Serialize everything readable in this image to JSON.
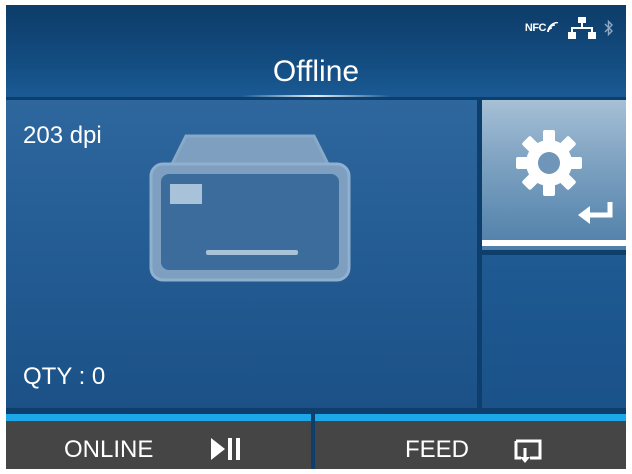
{
  "status": {
    "title": "Offline",
    "nfc_label": "NFC",
    "icons": [
      "nfc-icon",
      "network-icon",
      "bluetooth-icon"
    ]
  },
  "main": {
    "resolution": "203 dpi",
    "quantity": "QTY : 0",
    "icon": "printer-icon"
  },
  "settings": {
    "icons": [
      "gear-icon",
      "enter-icon"
    ]
  },
  "softkeys": {
    "online_label": "ONLINE",
    "online_icon": "play-pause-icon",
    "feed_label": "FEED",
    "feed_icon": "feed-icon"
  },
  "colors": {
    "background": "#0e3f6c",
    "panel": "#245d94",
    "softkey": "#454545",
    "accent": "#1ba7e8",
    "settings_tile": "#7fa3c2"
  }
}
